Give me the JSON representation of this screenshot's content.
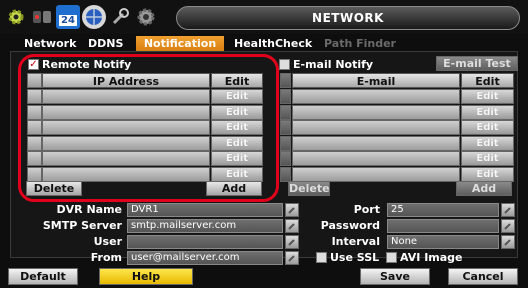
{
  "window": {
    "title": "NETWORK"
  },
  "toolbar_icons": [
    "gear-icon",
    "record-icon",
    "calendar-icon",
    "network-globe-icon",
    "tools-icon",
    "settings-gear-icon"
  ],
  "calendar_day": "24",
  "tabs": [
    {
      "label": "Network",
      "state": "normal"
    },
    {
      "label": "DDNS",
      "state": "normal"
    },
    {
      "label": "Notification",
      "state": "active"
    },
    {
      "label": "HealthCheck",
      "state": "normal"
    },
    {
      "label": "Path Finder",
      "state": "disabled"
    }
  ],
  "remote": {
    "checkbox_label": "Remote Notify",
    "checked": true,
    "col_address": "IP Address",
    "col_edit": "Edit",
    "row_edit_label": "Edit",
    "rows": [
      "",
      "",
      "",
      "",
      "",
      ""
    ],
    "delete_label": "Delete",
    "add_label": "Add"
  },
  "email": {
    "checkbox_label": "E-mail Notify",
    "checked": false,
    "test_label": "E-mail Test",
    "col_email": "E-mail",
    "col_edit": "Edit",
    "row_edit_label": "Edit",
    "rows": [
      "",
      "",
      "",
      "",
      "",
      ""
    ],
    "delete_label": "Delete",
    "add_label": "Add"
  },
  "form": {
    "dvr_name_label": "DVR Name",
    "dvr_name": "DVR1",
    "smtp_label": "SMTP Server",
    "smtp": "smtp.mailserver.com",
    "user_label": "User",
    "user": "",
    "from_label": "From",
    "from": "user@mailserver.com",
    "port_label": "Port",
    "port": "25",
    "password_label": "Password",
    "password": "",
    "interval_label": "Interval",
    "interval": "None",
    "use_ssl_label": "Use SSL",
    "avi_label": "AVI Image"
  },
  "footer": {
    "default_label": "Default",
    "help_label": "Help",
    "save_label": "Save",
    "cancel_label": "Cancel"
  },
  "colors": {
    "active_tab": "#e8901f",
    "highlight": "#e0001b",
    "help_button": "#f5cc1c"
  }
}
